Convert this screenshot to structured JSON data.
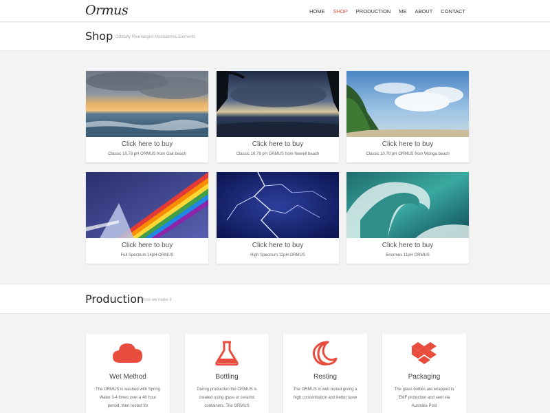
{
  "brand": {
    "logo_text": "Ormus"
  },
  "nav": {
    "items": [
      {
        "label": "HOME"
      },
      {
        "label": "SHOP"
      },
      {
        "label": "PRODUCTION"
      },
      {
        "label": "ME"
      },
      {
        "label": "ABOUT"
      },
      {
        "label": "CONTACT"
      }
    ],
    "active": "SHOP"
  },
  "shop": {
    "title": "Shop",
    "subtitle": "Orbitally Rearranged Monoatomic Elements",
    "products": [
      {
        "buy_label": "Click here to buy",
        "description": "Classic 10.78 pH ORMUS from Oak beach",
        "image": "ocean-sunset"
      },
      {
        "buy_label": "Click here to buy",
        "description": "Classic 10.78 pH ORMUS from Newell beach",
        "image": "palm-beach-storm"
      },
      {
        "buy_label": "Click here to buy",
        "description": "Classic 10.78 pH ORMUS from Wonga beach",
        "image": "tropical-beach"
      },
      {
        "buy_label": "Click here to buy",
        "description": "Full Spectrum 14pH ORMUS",
        "image": "prism-rainbow"
      },
      {
        "buy_label": "Click here to buy",
        "description": "High Spectrum 12pH ORMUS",
        "image": "lightning"
      },
      {
        "buy_label": "Click here to buy",
        "description": "Enormus 11pH ORMUS",
        "image": "wave"
      }
    ]
  },
  "production": {
    "title": "Production",
    "subtitle": "how we make it",
    "steps": [
      {
        "icon": "cloud-icon",
        "title": "Wet Method",
        "text": "The ORMUS is washed with Spring Water 3-4 times over a 48 hour period, then rested for"
      },
      {
        "icon": "flask-icon",
        "title": "Bottling",
        "text": "During production the ORMUS is created using glass or ceramic containers. The ORMUS"
      },
      {
        "icon": "moon-icon",
        "title": "Resting",
        "text": "The ORMUS is well rested giving a high concentration and better taste"
      },
      {
        "icon": "dropbox-icon",
        "title": "Packaging",
        "text": "The glass bottles are wrapped in EMF protection and sent via Australia Post"
      }
    ]
  },
  "colors": {
    "accent": "#e74c3c",
    "background": "#f3f3f3"
  }
}
